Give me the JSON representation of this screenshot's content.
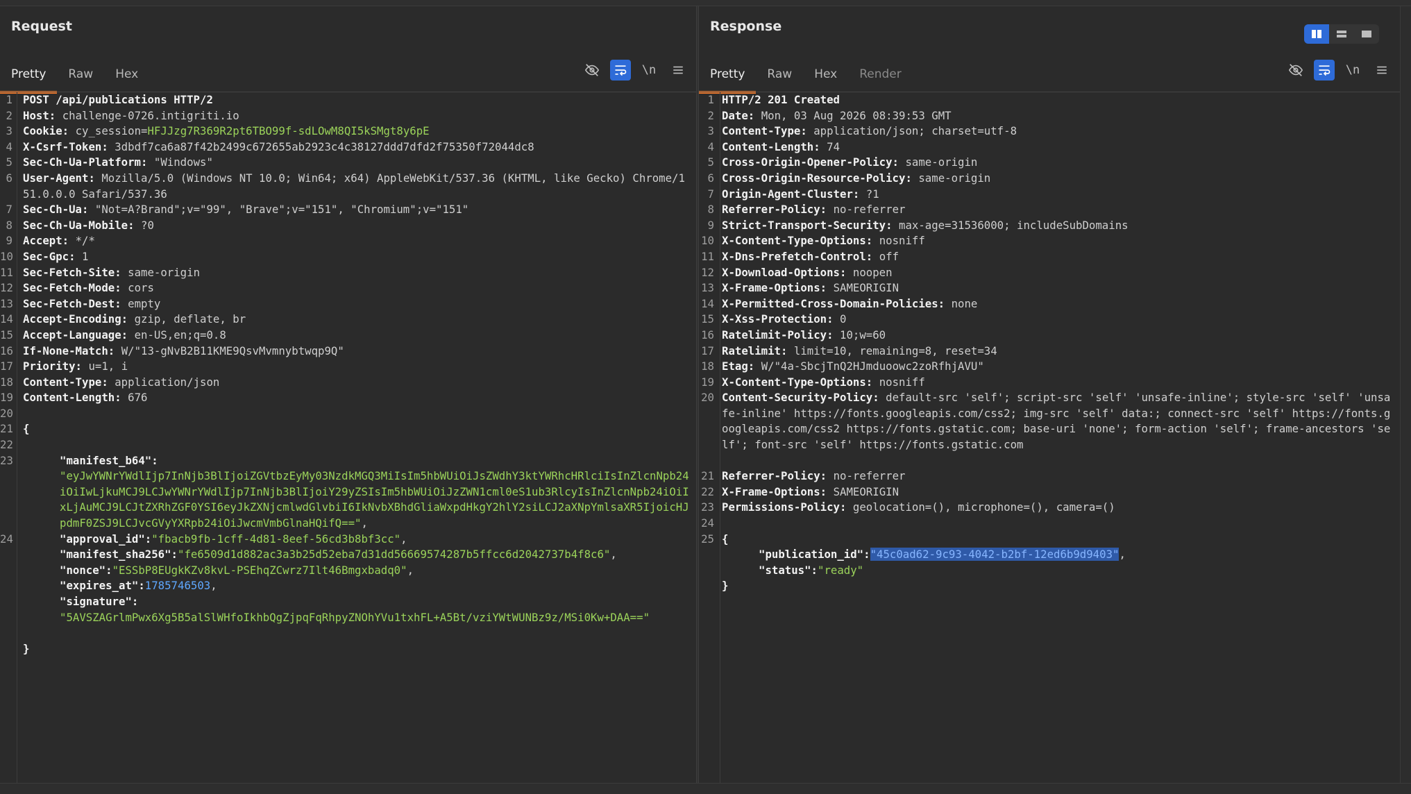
{
  "request": {
    "title": "Request",
    "tabs": [
      "Pretty",
      "Raw",
      "Hex"
    ],
    "active_tab": "Pretty",
    "tools": {
      "hide_icon": "eye-slash-icon",
      "wrap_icon": "wrap-lines-icon",
      "newline_label": "\\n",
      "menu_icon": "hamburger-menu-icon"
    },
    "lines": {
      "l1": "POST /api/publications HTTP/2",
      "l2k": "Host:",
      "l2v": "challenge-0726.intigriti.io",
      "l3k": "Cookie:",
      "l3a": "cy_session",
      "l3b": "=",
      "l3c": "HFJJzg7R369R2pt6TBO99f-sdLOwM8QI5kSMgt8y6pE",
      "l4k": "X-Csrf-Token:",
      "l4v": "3dbdf7ca6a87f42b2499c672655ab2923c4c38127ddd7dfd2f75350f72044dc8",
      "l5k": "Sec-Ch-Ua-Platform:",
      "l5v": "\"Windows\"",
      "l6k": "User-Agent:",
      "l6v": "Mozilla/5.0 (Windows NT 10.0; Win64; x64) AppleWebKit/537.36 (KHTML, like Gecko) Chrome/151.0.0.0 Safari/537.36",
      "l7k": "Sec-Ch-Ua:",
      "l7v": "\"Not=A?Brand\";v=\"99\", \"Brave\";v=\"151\", \"Chromium\";v=\"151\"",
      "l8k": "Sec-Ch-Ua-Mobile:",
      "l8v": "?0",
      "l9k": "Accept:",
      "l9v": "*/*",
      "l10k": "Sec-Gpc:",
      "l10v": "1",
      "l11k": "Sec-Fetch-Site:",
      "l11v": "same-origin",
      "l12k": "Sec-Fetch-Mode:",
      "l12v": "cors",
      "l13k": "Sec-Fetch-Dest:",
      "l13v": "empty",
      "l14k": "Accept-Encoding:",
      "l14v": "gzip, deflate, br",
      "l15k": "Accept-Language:",
      "l15v": "en-US,en;q=0.8",
      "l16k": "If-None-Match:",
      "l16v": "W/\"13-gNvB2B11KME9QsvMvmnybtwqp9Q\"",
      "l17k": "Priority:",
      "l17v": "u=1, i",
      "l18k": "Content-Type:",
      "l18v": "application/json",
      "l19k": "Content-Length:",
      "l19v": "676",
      "l21": "{",
      "l23k": "\"manifest_b64\":",
      "l23v": "\"eyJwYWNrYWdlIjp7InNjb3BlIjoiZGVtbzEyMy03NzdkMGQ3MiIsIm5hbWUiOiJsZWdhY3ktYWRhcHRlciIsInZlcnNpb24iOiIwLjkuMCJ9LCJwYWNrYWdlIjp7InNjb3BlIjoiY29yZSIsIm5hbWUiOiJzZWN1cml0eS1ub3RlcyIsInZlcnNpb24iOiIxLjAuMCJ9LCJtZXRhZGF0YSI6eyJkZXNjcmlwdGlvbiI6IkNvbXBhdGliaWxpdHkgY2hlY2siLCJ2aXNpYmlsaXR5IjoicHJpdmF0ZSJ9LCJvcGVyYXRpb24iOiJwcmVmbGlnaHQifQ==\"",
      "l23c": ",",
      "l24k": "\"approval_id\":",
      "l24v": "\"fbacb9fb-1cff-4d81-8eef-56cd3b8bf3cc\"",
      "l25k": "\"manifest_sha256\":",
      "l25v": "\"fe6509d1d882ac3a3b25d52eba7d31dd56669574287b5ffcc6d2042737b4f8c6\"",
      "l26k": "\"nonce\":",
      "l26v": "\"ESSbP8EUgkKZv8kvL-PSEhqZCwrz7Ilt46Bmgxbadq0\"",
      "l27k": "\"expires_at\":",
      "l27v": "1785746503",
      "l28k": "\"signature\":",
      "l28v": "\"5AVSZAGrlmPwx6Xg5B5alSlWHfoIkhbQgZjpqFqRhpyZNOhYVu1txhFL+A5Bt/vziYWtWUNBz9z/MSi0Kw+DAA==\"",
      "l29": "}",
      "comma": ","
    }
  },
  "response": {
    "title": "Response",
    "tabs": [
      "Pretty",
      "Raw",
      "Hex",
      "Render"
    ],
    "active_tab": "Pretty",
    "tools": {
      "hide_icon": "eye-slash-icon",
      "wrap_icon": "wrap-lines-icon",
      "newline_label": "\\n",
      "menu_icon": "hamburger-menu-icon"
    },
    "view_toggle_icons": [
      "split-vertical-icon",
      "split-horizontal-icon",
      "single-pane-icon"
    ],
    "lines": {
      "l1": "HTTP/2 201 Created",
      "l2k": "Date:",
      "l2v": "Mon, 03 Aug 2026 08:39:53 GMT",
      "l3k": "Content-Type:",
      "l3v": "application/json; charset=utf-8",
      "l4k": "Content-Length:",
      "l4v": "74",
      "l5k": "Cross-Origin-Opener-Policy:",
      "l5v": "same-origin",
      "l6k": "Cross-Origin-Resource-Policy:",
      "l6v": "same-origin",
      "l7k": "Origin-Agent-Cluster:",
      "l7v": "?1",
      "l8k": "Referrer-Policy:",
      "l8v": "no-referrer",
      "l9k": "Strict-Transport-Security:",
      "l9v": "max-age=31536000; includeSubDomains",
      "l10k": "X-Content-Type-Options:",
      "l10v": "nosniff",
      "l11k": "X-Dns-Prefetch-Control:",
      "l11v": "off",
      "l12k": "X-Download-Options:",
      "l12v": "noopen",
      "l13k": "X-Frame-Options:",
      "l13v": "SAMEORIGIN",
      "l14k": "X-Permitted-Cross-Domain-Policies:",
      "l14v": "none",
      "l15k": "X-Xss-Protection:",
      "l15v": "0",
      "l16k": "Ratelimit-Policy:",
      "l16v": "10;w=60",
      "l17k": "Ratelimit:",
      "l17v": "limit=10, remaining=8, reset=34",
      "l18k": "Etag:",
      "l18v": "W/\"4a-SbcjTnQ2HJmduoowc2zoRfhjAVU\"",
      "l19k": "X-Content-Type-Options:",
      "l19v": "nosniff",
      "l20k": "Content-Security-Policy:",
      "l20v": "default-src 'self'; script-src 'self' 'unsafe-inline'; style-src 'self' 'unsafe-inline' https://fonts.googleapis.com/css2; img-src 'self' data:; connect-src 'self' https://fonts.googleapis.com/css2 https://fonts.gstatic.com; base-uri 'none'; form-action 'self'; frame-ancestors 'self'; font-src 'self' https://fonts.gstatic.com",
      "l21k": "Referrer-Policy:",
      "l21v": "no-referrer",
      "l22k": "X-Frame-Options:",
      "l22v": "SAMEORIGIN",
      "l23k": "Permissions-Policy:",
      "l23v": "geolocation=(), microphone=(), camera=()",
      "l25": "{",
      "l26k": "\"publication_id\":",
      "l26v": "\"45c0ad62-9c93-4042-b2bf-12ed6b9d9403\"",
      "l26c": ",",
      "l27k": "\"status\":",
      "l27v": "\"ready\"",
      "l28": "}"
    }
  }
}
